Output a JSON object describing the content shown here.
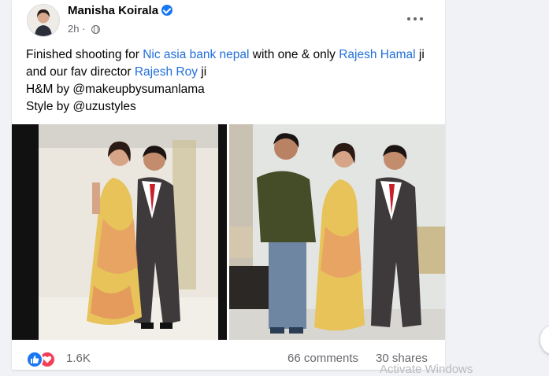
{
  "post": {
    "author": "Manisha Koirala",
    "time": "2h",
    "icons": {
      "verified": "verified-badge-icon",
      "privacy": "globe-icon",
      "more": "more-options-icon"
    },
    "text": {
      "part1": "Finished shooting for ",
      "link_company": "Nic asia bank nepal",
      "part2": " with one & only ",
      "link_actor": "Rajesh Hamal",
      "part3": " ji and our fav director ",
      "link_director": "Rajesh Roy",
      "part4": " ji",
      "line_hm": "H&M by @makeupbysumanlama",
      "line_style": "Style by @uzustyles"
    },
    "photos": [
      {
        "description_icon": "photo-thumbnail"
      },
      {
        "description_icon": "photo-thumbnail"
      }
    ]
  },
  "stats": {
    "reaction_icons": [
      "like-icon",
      "love-icon"
    ],
    "reaction_count": "1.6K",
    "comments": "66 comments",
    "shares": "30 shares"
  },
  "overlay": {
    "watermark": "Activate Windows"
  },
  "colors": {
    "link": "#216fdb",
    "like": "#1877f2",
    "love": "#f33e58",
    "background": "#f0f2f5"
  }
}
